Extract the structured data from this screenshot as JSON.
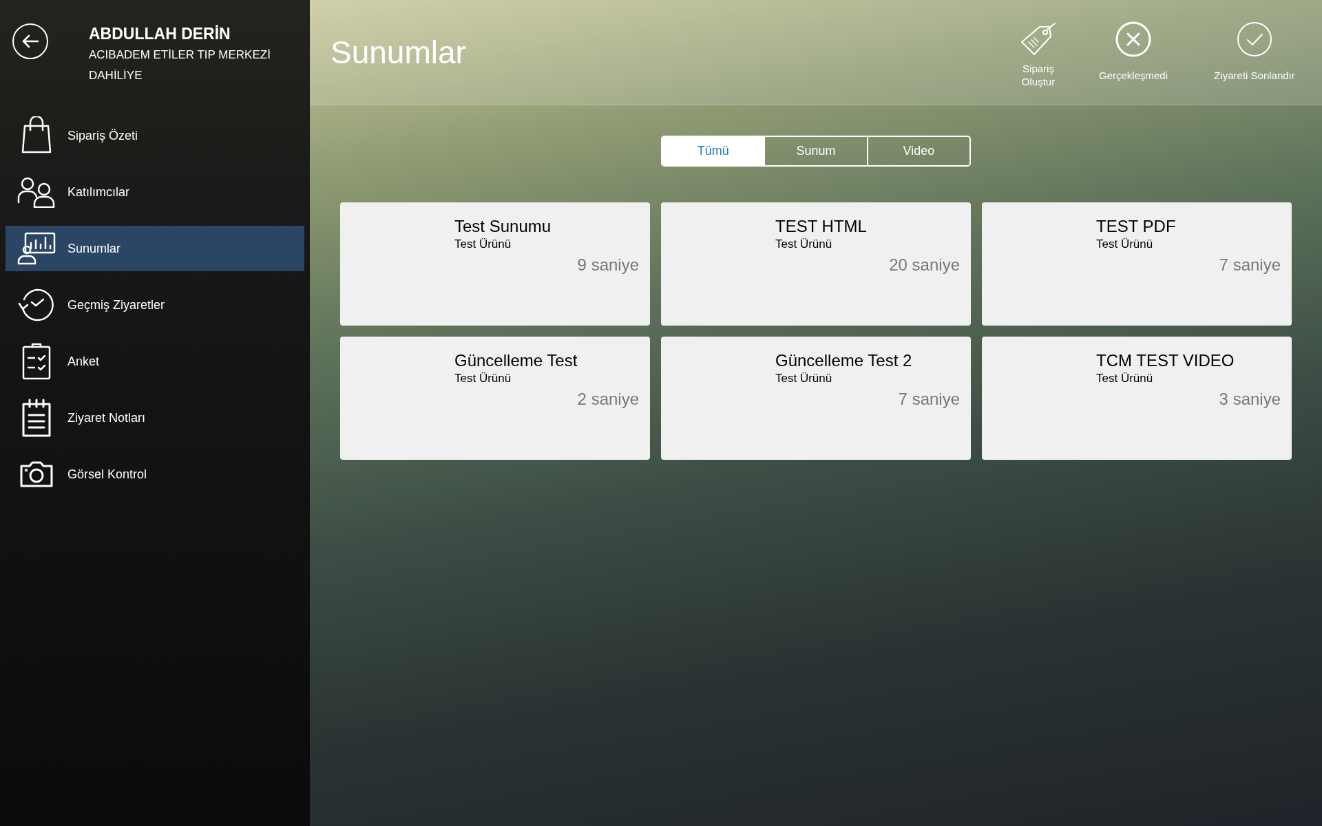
{
  "sidebar": {
    "header": {
      "name": "ABDULLAH DERİN",
      "institution": "ACIBADEM ETİLER TIP MERKEZİ",
      "department": "DAHİLİYE"
    },
    "items": [
      {
        "label": "Sipariş Özeti",
        "selected": false
      },
      {
        "label": "Katılımcılar",
        "selected": false
      },
      {
        "label": "Sunumlar",
        "selected": true
      },
      {
        "label": "Geçmiş Ziyaretler",
        "selected": false
      },
      {
        "label": "Anket",
        "selected": false
      },
      {
        "label": "Ziyaret Notları",
        "selected": false
      },
      {
        "label": "Görsel Kontrol",
        "selected": false
      }
    ]
  },
  "header": {
    "title": "Sunumlar",
    "actions": [
      {
        "label": "Sipariş Oluştur"
      },
      {
        "label": "Gerçekleşmedi"
      },
      {
        "label": "Ziyareti Sonlandır"
      }
    ]
  },
  "tabs": [
    {
      "label": "Tümü",
      "selected": true
    },
    {
      "label": "Sunum",
      "selected": false
    },
    {
      "label": "Video",
      "selected": false
    }
  ],
  "cards": [
    {
      "title": "Test Sunumu",
      "subtitle": "Test Ürünü",
      "duration": "9 saniye"
    },
    {
      "title": "TEST HTML",
      "subtitle": "Test Ürünü",
      "duration": "20 saniye"
    },
    {
      "title": "TEST PDF",
      "subtitle": "Test Ürünü",
      "duration": "7 saniye"
    },
    {
      "title": "Güncelleme Test",
      "subtitle": "Test Ürünü",
      "duration": "2 saniye"
    },
    {
      "title": "Güncelleme Test 2",
      "subtitle": "Test Ürünü",
      "duration": "7 saniye"
    },
    {
      "title": "TCM TEST VIDEO",
      "subtitle": "Test Ürünü",
      "duration": "3 saniye"
    }
  ]
}
